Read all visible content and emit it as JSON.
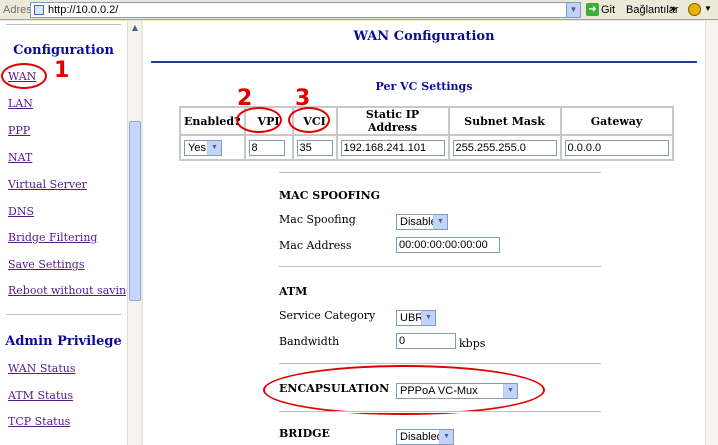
{
  "addressbar": {
    "label": "Adres",
    "url": "http://10.0.0.2/",
    "go_label": "Git",
    "links_label": "Bağlantılar",
    "links_chevron": "»"
  },
  "sidebar": {
    "configuration_title": "Configuration",
    "config_links": [
      "WAN",
      "LAN",
      "PPP",
      "NAT",
      "Virtual Server",
      "DNS",
      "Bridge Filtering",
      "Save Settings",
      "Reboot without saving"
    ],
    "admin_title": "Admin Privilege",
    "admin_links": [
      "WAN Status",
      "ATM Status",
      "TCP Status"
    ]
  },
  "main": {
    "title": "WAN Configuration",
    "per_vc": {
      "title": "Per VC Settings",
      "headers": [
        "Enabled?",
        "VPI",
        "VCI",
        "Static IP Address",
        "Subnet Mask",
        "Gateway"
      ],
      "enabled": "Yes",
      "vpi": "8",
      "vci": "35",
      "static_ip": "192.168.241.101",
      "subnet_mask": "255.255.255.0",
      "gateway": "0.0.0.0"
    },
    "mac_spoofing": {
      "title": "MAC SPOOFING",
      "spoof_label": "Mac Spoofing",
      "spoof_value": "Disable",
      "address_label": "Mac Address",
      "address_value": "00:00:00:00:00:00"
    },
    "atm": {
      "title": "ATM",
      "category_label": "Service Category",
      "category_value": "UBR",
      "bandwidth_label": "Bandwidth",
      "bandwidth_value": "0",
      "bandwidth_unit": "kbps"
    },
    "encapsulation": {
      "title": "ENCAPSULATION",
      "value": "PPPoA VC-Mux"
    },
    "bridge": {
      "title": "BRIDGE",
      "value": "Disabled"
    }
  },
  "annotations": {
    "n1": "1",
    "n2": "2",
    "n3": "3",
    "color": "#e00000"
  },
  "icons": [
    "page-icon",
    "dropdown-arrow-icon",
    "go-arrow-icon",
    "norton-icon",
    "scroll-up-arrow-icon"
  ]
}
